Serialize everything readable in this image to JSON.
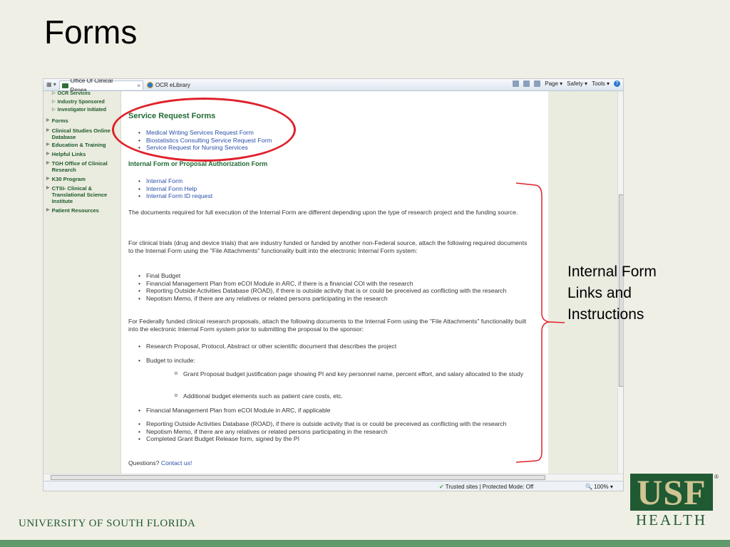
{
  "slide": {
    "title": "Forms",
    "annotation": "Internal Form Links and Instructions",
    "university": "UNIVERSITY OF  SOUTH FLORIDA",
    "logo_text": "USF",
    "logo_sub": "HEALTH",
    "logo_reg": "®"
  },
  "browser": {
    "tabs": [
      {
        "label": "Office Of Clinical Resea...",
        "close": "×"
      },
      {
        "label": "OCR eLibrary"
      }
    ],
    "toolbar": {
      "page": "Page ▾",
      "safety": "Safety ▾",
      "tools": "Tools ▾",
      "help": "?"
    },
    "status": {
      "text": "Trusted sites | Protected Mode: Off",
      "zoom": "100%"
    }
  },
  "sidebar": {
    "items": [
      {
        "label": "OCR Services",
        "sub": true
      },
      {
        "label": "Industry Sponsored",
        "sub": true
      },
      {
        "label": "Investigator Initiated",
        "sub": true
      },
      {
        "label": "Forms"
      },
      {
        "label": "Clinical Studies Online Database"
      },
      {
        "label": "Education & Training"
      },
      {
        "label": "Helpful Links"
      },
      {
        "label": "TGH Office of Clinical Research"
      },
      {
        "label": "K30 Program"
      },
      {
        "label": "CTSI- Clinical & Translational Science Institute"
      },
      {
        "label": "Patient Resources"
      }
    ]
  },
  "content": {
    "service_heading": "Service Request Forms",
    "service_links": [
      "Medical Writing Services Request Form",
      "Biostatistics Consulting Service Request Form",
      "Service Request for Nursing Services"
    ],
    "internal_heading": "Internal Form or Proposal Authorization Form",
    "internal_links": [
      "Internal Form",
      "Internal Form Help",
      "Internal Form ID request"
    ],
    "para1": "The documents required for full execution of the Internal Form are different depending upon the type of research project and the funding source.",
    "para2": "For clinical trials (drug and device trials) that are industry funded or funded by another non-Federal source, attach the following required documents to the Internal Form using the \"File Attachments\" functionality built into the electronic Internal Form system:",
    "list1": [
      "Final Budget",
      "Financial Management Plan from eCOI Module in ARC, if there is a financial COI with the research",
      "Reporting Outside Activities Database (ROAD), if there is outside activity that is or could be preceived as conflicting with the research",
      "Nepotism Memo, if there are any relatives or related persons participating in the research"
    ],
    "para3": "For Federally funded clinical research proposals, attach the following documents to the Internal Form using the \"File Attachments\" functionality built into the electronic Internal Form system prior to submitting the proposal to the sponsor:",
    "list2a": "Research Proposal, Protocol, Abstract or other scientific document that describes the project",
    "list2b": "Budget to include:",
    "sublist": [
      "Grant Proposal budget justification page showing PI and key personnel name, percent effort, and salary allocated to the study",
      "Additional budget elements such as patient care costs, etc."
    ],
    "list2c": "Financial Management Plan from eCOI Module in ARC, if applicable",
    "list2d": [
      "Reporting Outside Activities Database (ROAD), if there is outside activity that is or could be preceived as conflicting with the research",
      "Nepotism Memo, if there are any relatives or related persons participating in the research",
      "Completed Grant Budget Release form, signed by the PI"
    ],
    "questions": "Questions?",
    "contact": "Contact us!"
  },
  "colors": {
    "accent_red": "#e0202a",
    "usf_green": "#1f5a33",
    "usf_gold": "#cfc493",
    "link": "#2a4fa8"
  }
}
